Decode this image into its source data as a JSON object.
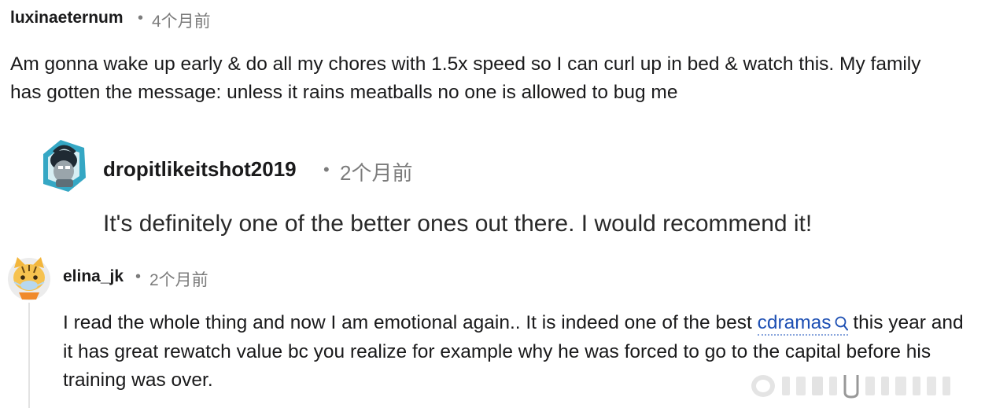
{
  "comments": [
    {
      "username": "luxinaeternum",
      "separator": "•",
      "timestamp": "4个月前",
      "body_lines": [
        "Am gonna wake up early & do all my chores with 1.5x speed so I can curl up in bed & watch this. My family",
        "has gotten the message: unless it rains meatballs no one is allowed to bug me"
      ]
    },
    {
      "username": "dropitlikeitshot2019",
      "separator": "•",
      "timestamp": "2个月前",
      "avatar_icon": "robot-avatar-icon",
      "body_lines": [
        "It's definitely one of the better ones out there. I would recommend it!"
      ]
    },
    {
      "username": "elina_jk",
      "separator": "•",
      "timestamp": "2个月前",
      "avatar_icon": "tiger-avatar-icon",
      "body_line1_before": "I read the whole thing and now I am emotional again.. It is indeed one of the best ",
      "link_text": "cdramas",
      "link_icon": "search-icon",
      "body_line1_after": " this year and",
      "body_lines_rest": [
        "it has great rewatch value bc you realize for example why he was forced to go to the capital before his",
        "training was over."
      ]
    }
  ],
  "colors": {
    "text": "#1a1a1b",
    "meta": "#7c7c7c",
    "link": "#1d4fb3",
    "thread_line": "#e3e3e3"
  }
}
